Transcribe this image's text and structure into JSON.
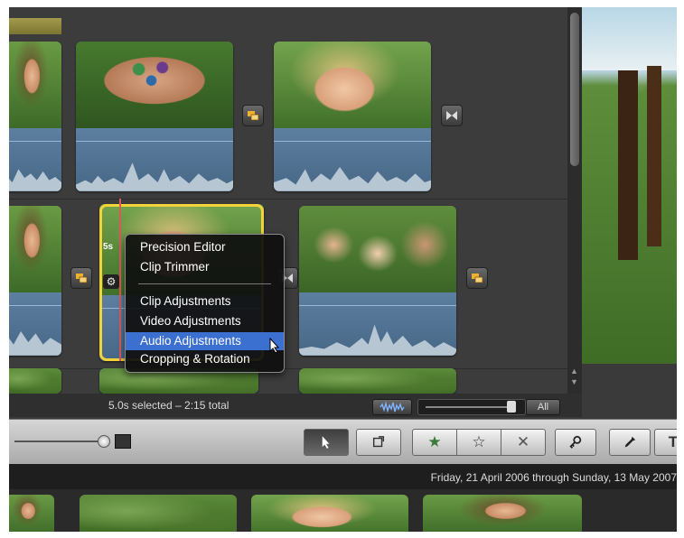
{
  "context_menu": {
    "items": [
      {
        "label": "Precision Editor"
      },
      {
        "label": "Clip Trimmer"
      },
      {
        "label": "Clip Adjustments"
      },
      {
        "label": "Video Adjustments"
      },
      {
        "label": "Audio Adjustments"
      },
      {
        "label": "Cropping & Rotation"
      }
    ],
    "highlighted": "Audio Adjustments"
  },
  "selected_clip": {
    "duration_label": "5s"
  },
  "status": {
    "selection_text": "5.0s selected – 2:15 total",
    "zoom_all_label": "All"
  },
  "event_browser": {
    "date_range": "Friday, 21 April 2006 through Sunday, 13 May 2007"
  },
  "colors": {
    "selection_border": "#f2d43a",
    "menu_highlight": "#3b6fd0",
    "playhead": "#d65a5a"
  },
  "icons": {
    "arrow_tool": "arrow-pointer-icon",
    "crop_tool": "crop-icon",
    "favorite": "star-filled-icon",
    "unmark": "star-outline-icon",
    "reject": "x-icon",
    "keyword": "key-icon",
    "inspector": "eyedropper-icon",
    "title": "title-t-icon",
    "transition": "transition-icon",
    "gear": "gear-icon"
  }
}
